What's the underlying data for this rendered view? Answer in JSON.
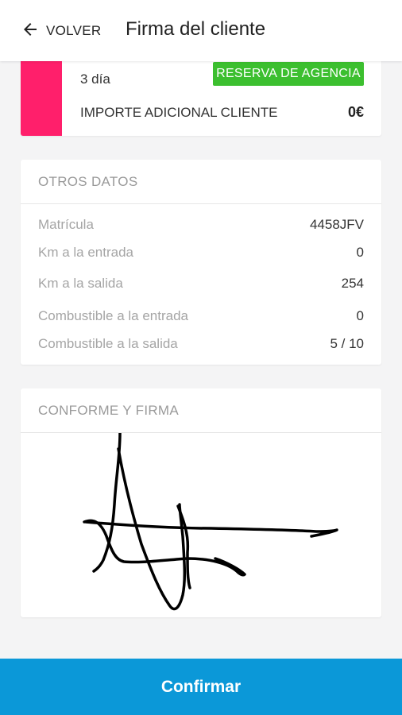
{
  "header": {
    "back_label": "VOLVER",
    "title": "Firma del cliente"
  },
  "booking": {
    "days": "3 día",
    "badge": "RESERVA DE AGENCIA",
    "extra_label": "IMPORTE ADICIONAL CLIENTE",
    "extra_value": "0€"
  },
  "otros": {
    "title": "OTROS DATOS",
    "rows": [
      {
        "label": "Matrícula",
        "value": "4458JFV"
      },
      {
        "label": "Km a la entrada",
        "value": "0"
      },
      {
        "label": "Km a la salida",
        "value": "254"
      },
      {
        "label": "Combustible a la entrada",
        "value": "0"
      },
      {
        "label": "Combustible a la salida",
        "value": "5 / 10"
      }
    ]
  },
  "firma": {
    "title": "CONFORME Y FIRMA"
  },
  "footer": {
    "confirm_label": "Confirmar"
  },
  "colors": {
    "accent": "#ff1f6b",
    "badge": "#3cbf2f",
    "primary": "#0b98d8"
  },
  "icons": {
    "back": "arrow-left-icon"
  }
}
